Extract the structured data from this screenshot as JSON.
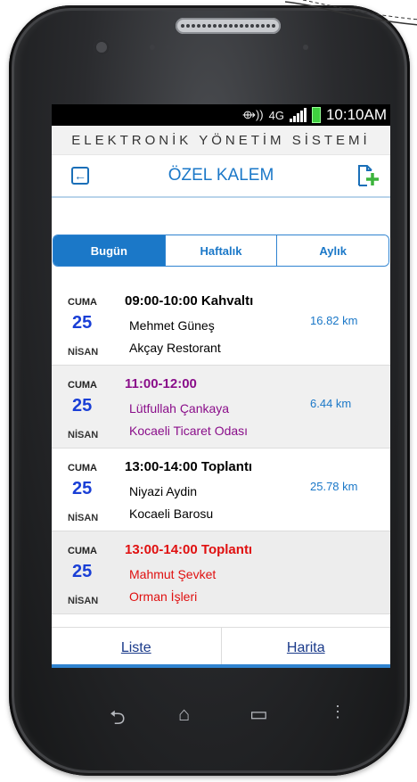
{
  "status": {
    "time": "10:10AM",
    "network": "4G"
  },
  "app": {
    "title": "ELEKTRONİK YÖNETİM SİSTEMİ"
  },
  "header": {
    "title": "ÖZEL KALEM"
  },
  "tabs": [
    {
      "label": "Bugün",
      "active": true
    },
    {
      "label": "Haftalık",
      "active": false
    },
    {
      "label": "Aylık",
      "active": false
    }
  ],
  "appointments": [
    {
      "day": "CUMA",
      "date": "25",
      "month": "NİSAN",
      "time": "09:00-10:00  Kahvaltı",
      "name": "Mehmet Güneş",
      "place": "Akçay Restorant",
      "distance": "16.82 km"
    },
    {
      "day": "CUMA",
      "date": "25",
      "month": "NİSAN",
      "time": "11:00-12:00",
      "name": "Lütfullah Çankaya",
      "place": "Kocaeli Ticaret Odası",
      "distance": "6.44 km"
    },
    {
      "day": "CUMA",
      "date": "25",
      "month": "NİSAN",
      "time": "13:00-14:00  Toplantı",
      "name": "Niyazi Aydin",
      "place": "Kocaeli Barosu",
      "distance": "25.78 km"
    },
    {
      "day": "CUMA",
      "date": "25",
      "month": "NİSAN",
      "time": "13:00-14:00  Toplantı",
      "name": "Mahmut Şevket",
      "place": "Orman İşleri",
      "distance": ""
    }
  ],
  "bottom": {
    "list_label": "Liste",
    "map_label": "Harita"
  },
  "colors": {
    "accent": "#1b78c8",
    "purple": "#8a0e8a",
    "red": "#e01010"
  }
}
